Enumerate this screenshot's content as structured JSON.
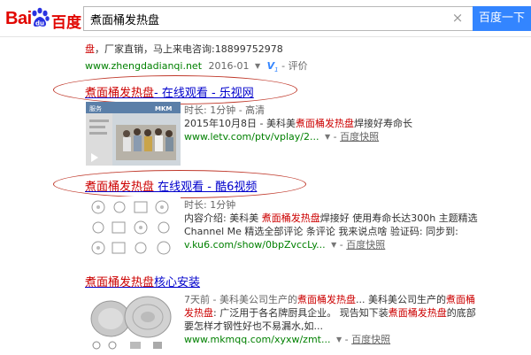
{
  "header": {
    "logo_bai": "Bai",
    "logo_du": "百度",
    "search_value": "煮面桶发热盘",
    "clear_glyph": "×",
    "search_button": "百度一下"
  },
  "top_result": {
    "snippet_hl": "盘",
    "snippet_rest": "，厂家直销，马上来电咨询:18899752978",
    "url": "www.zhengdadianqi.net",
    "date": "2016-01",
    "v_label": "V",
    "v_sub": "1",
    "review": "评价"
  },
  "results": [
    {
      "title_hl": "煮面桶发热盘",
      "title_rest": "- 在线观看 - 乐视网",
      "line1": "时长: 1分钟 - 高清",
      "line2_pre": "2015年10月8日 - 美科美",
      "line2_hl": "煮面桶发热盘",
      "line2_post": "焊接好寿命长",
      "url": "www.letv.com/ptv/vplay/2...",
      "snapshot": "百度快照",
      "thumb_header_left": "服务",
      "thumb_header_right": "MKM"
    },
    {
      "title_hl": "煮面桶发热盘",
      "title_rest": " 在线观看 - 酷6视频",
      "line1": "时长: 1分钟",
      "line2_pre": "内容介绍: 美科美 ",
      "line2_hl": "煮面桶发热盘",
      "line2_post": "焊接好 使用寿命长达300h 主题精选",
      "line3": "Channel Me 精选全部评论 条评论 我来说点啥 验证码: 同步到:",
      "url": "v.ku6.com/show/0bpZvccLy...",
      "snapshot": "百度快照"
    },
    {
      "title_hl": "煮面桶发热盘",
      "title_rest": "核心安装",
      "line1_pre": "7天前 - 美科美公司生产的",
      "line1_hl": "煮面桶发热盘",
      "line1_mid": "... 美科美公司生产的",
      "line1_hl2": "煮面桶",
      "line2_hl": "发热盘",
      "line2_post": ": 广泛用于各名牌厨具企业。 现告知下装",
      "line2_hl2": "煮面桶发热盘",
      "line2_post2": "的底部",
      "line3": "要怎样才钢性好也不易漏水,如...",
      "url": "www.mkmqq.com/xyxw/zmt...",
      "snapshot": "百度快照"
    }
  ],
  "colors": {
    "brand_red": "#e10601",
    "link_blue": "#0000cc",
    "highlight_red": "#c00",
    "url_green": "#008000",
    "button_blue": "#3385ff",
    "annotation_oval": "#c0392b"
  }
}
